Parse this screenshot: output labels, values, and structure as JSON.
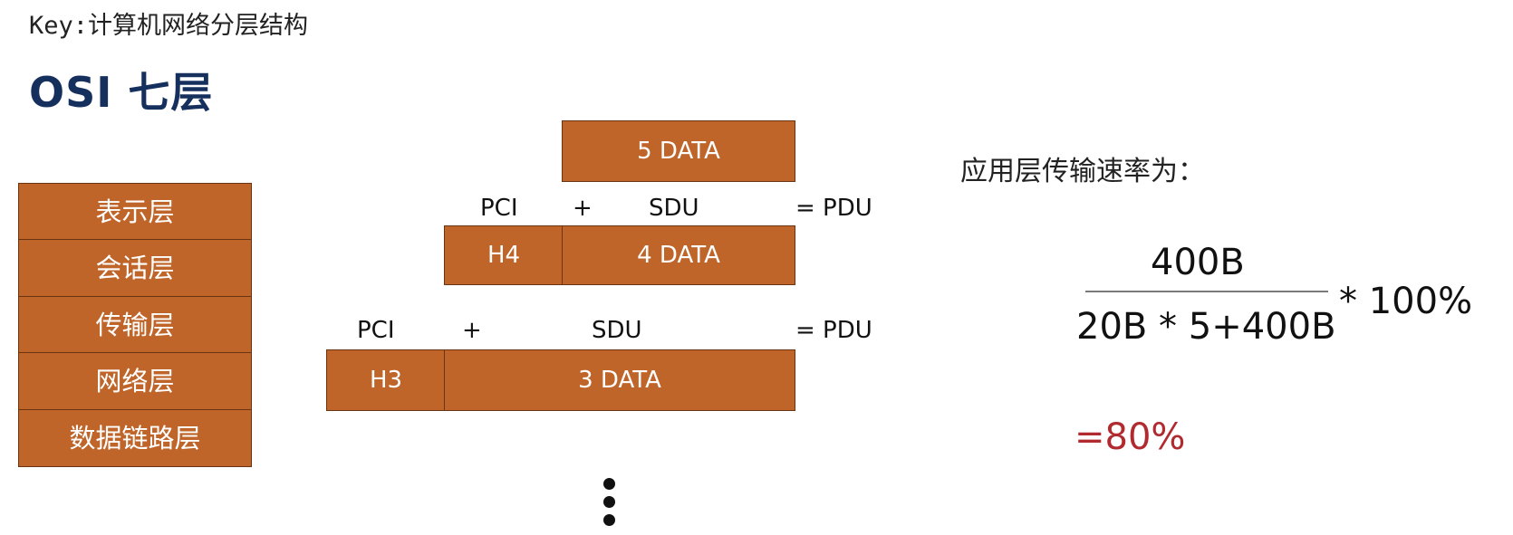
{
  "header": {
    "key": "Key:计算机网络分层结构",
    "title": "OSI 七层"
  },
  "layers": [
    "表示层",
    "会话层",
    "传输层",
    "网络层",
    "数据链路层"
  ],
  "encapsulation": {
    "top_data": "5 DATA",
    "row4": {
      "pci": "PCI",
      "plus": "+",
      "sdu": "SDU",
      "equals": "= PDU",
      "header": "H4",
      "data": "4 DATA"
    },
    "row3": {
      "pci": "PCI",
      "plus": "+",
      "sdu": "SDU",
      "equals": "= PDU",
      "header": "H3",
      "data": "3 DATA"
    }
  },
  "rate": {
    "caption": "应用层传输速率为：",
    "numerator": "400B",
    "denominator": "20B * 5+400B",
    "multiplier": "* 100%",
    "result": "=80%"
  },
  "colors": {
    "box_fill": "#c0652a",
    "box_border": "#6a3413",
    "title": "#16305e",
    "result": "#b02a30"
  }
}
